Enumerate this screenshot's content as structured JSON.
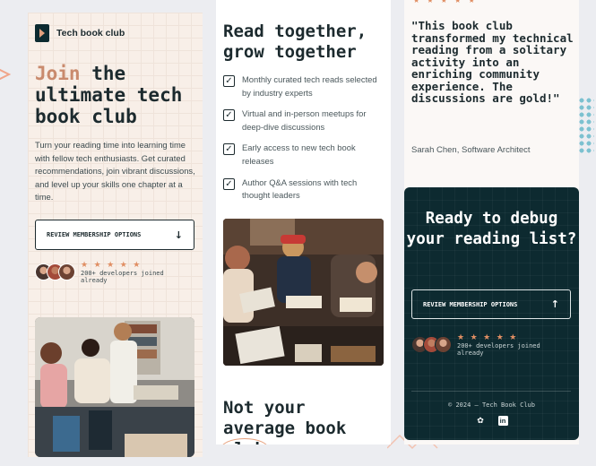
{
  "brand": {
    "name": "Tech book club",
    "icon": "bookmark-play-logo"
  },
  "hero": {
    "title_accent": "Join",
    "title_rest": " the ultimate tech book club",
    "subtitle": "Turn your reading time into learning time with fellow tech enthusiasts. Get curated recommendations, join vibrant discussions, and level up your skills one chapter at a time.",
    "cta_label": "REVIEW MEMBERSHIP OPTIONS",
    "cta_icon": "arrow-down-icon"
  },
  "social_proof": {
    "stars": "★ ★ ★ ★ ★",
    "joined_text": "200+ developers joined already"
  },
  "benefits": {
    "title": "Read together, grow together",
    "items": [
      {
        "label": "Monthly curated tech reads selected by industry experts"
      },
      {
        "label": "Virtual and in-person meetups for deep-dive discussions"
      },
      {
        "label": "Early access to new tech book releases"
      },
      {
        "label": "Author Q&A sessions with tech thought leaders"
      }
    ],
    "check_glyph": "✓"
  },
  "section2": {
    "title_before": "Not your average book ",
    "title_circled": "club"
  },
  "testimonial": {
    "stars": "★ ★ ★ ★ ★",
    "quote": "\"This book club transformed my technical reading from a solitary activity into an enriching community experience. The discussions are gold!\"",
    "author": "Sarah Chen, Software Architect"
  },
  "cta_card": {
    "title": "Ready to debug your reading list?",
    "button_label": "REVIEW MEMBERSHIP OPTIONS",
    "button_icon": "arrow-up-icon",
    "stars": "★ ★ ★ ★ ★",
    "joined_text": "200+ developers joined already"
  },
  "footer": {
    "copyright": "© 2024 – Tech Book Club",
    "social": [
      {
        "name": "bluesky-icon",
        "glyph": "✿"
      },
      {
        "name": "linkedin-icon",
        "glyph": "in"
      }
    ]
  },
  "colors": {
    "accent": "#c98a6d",
    "star": "#e08e63",
    "dark": "#0d2a30",
    "text": "#1c2a2e",
    "hero_bg": "#f8efe8"
  }
}
